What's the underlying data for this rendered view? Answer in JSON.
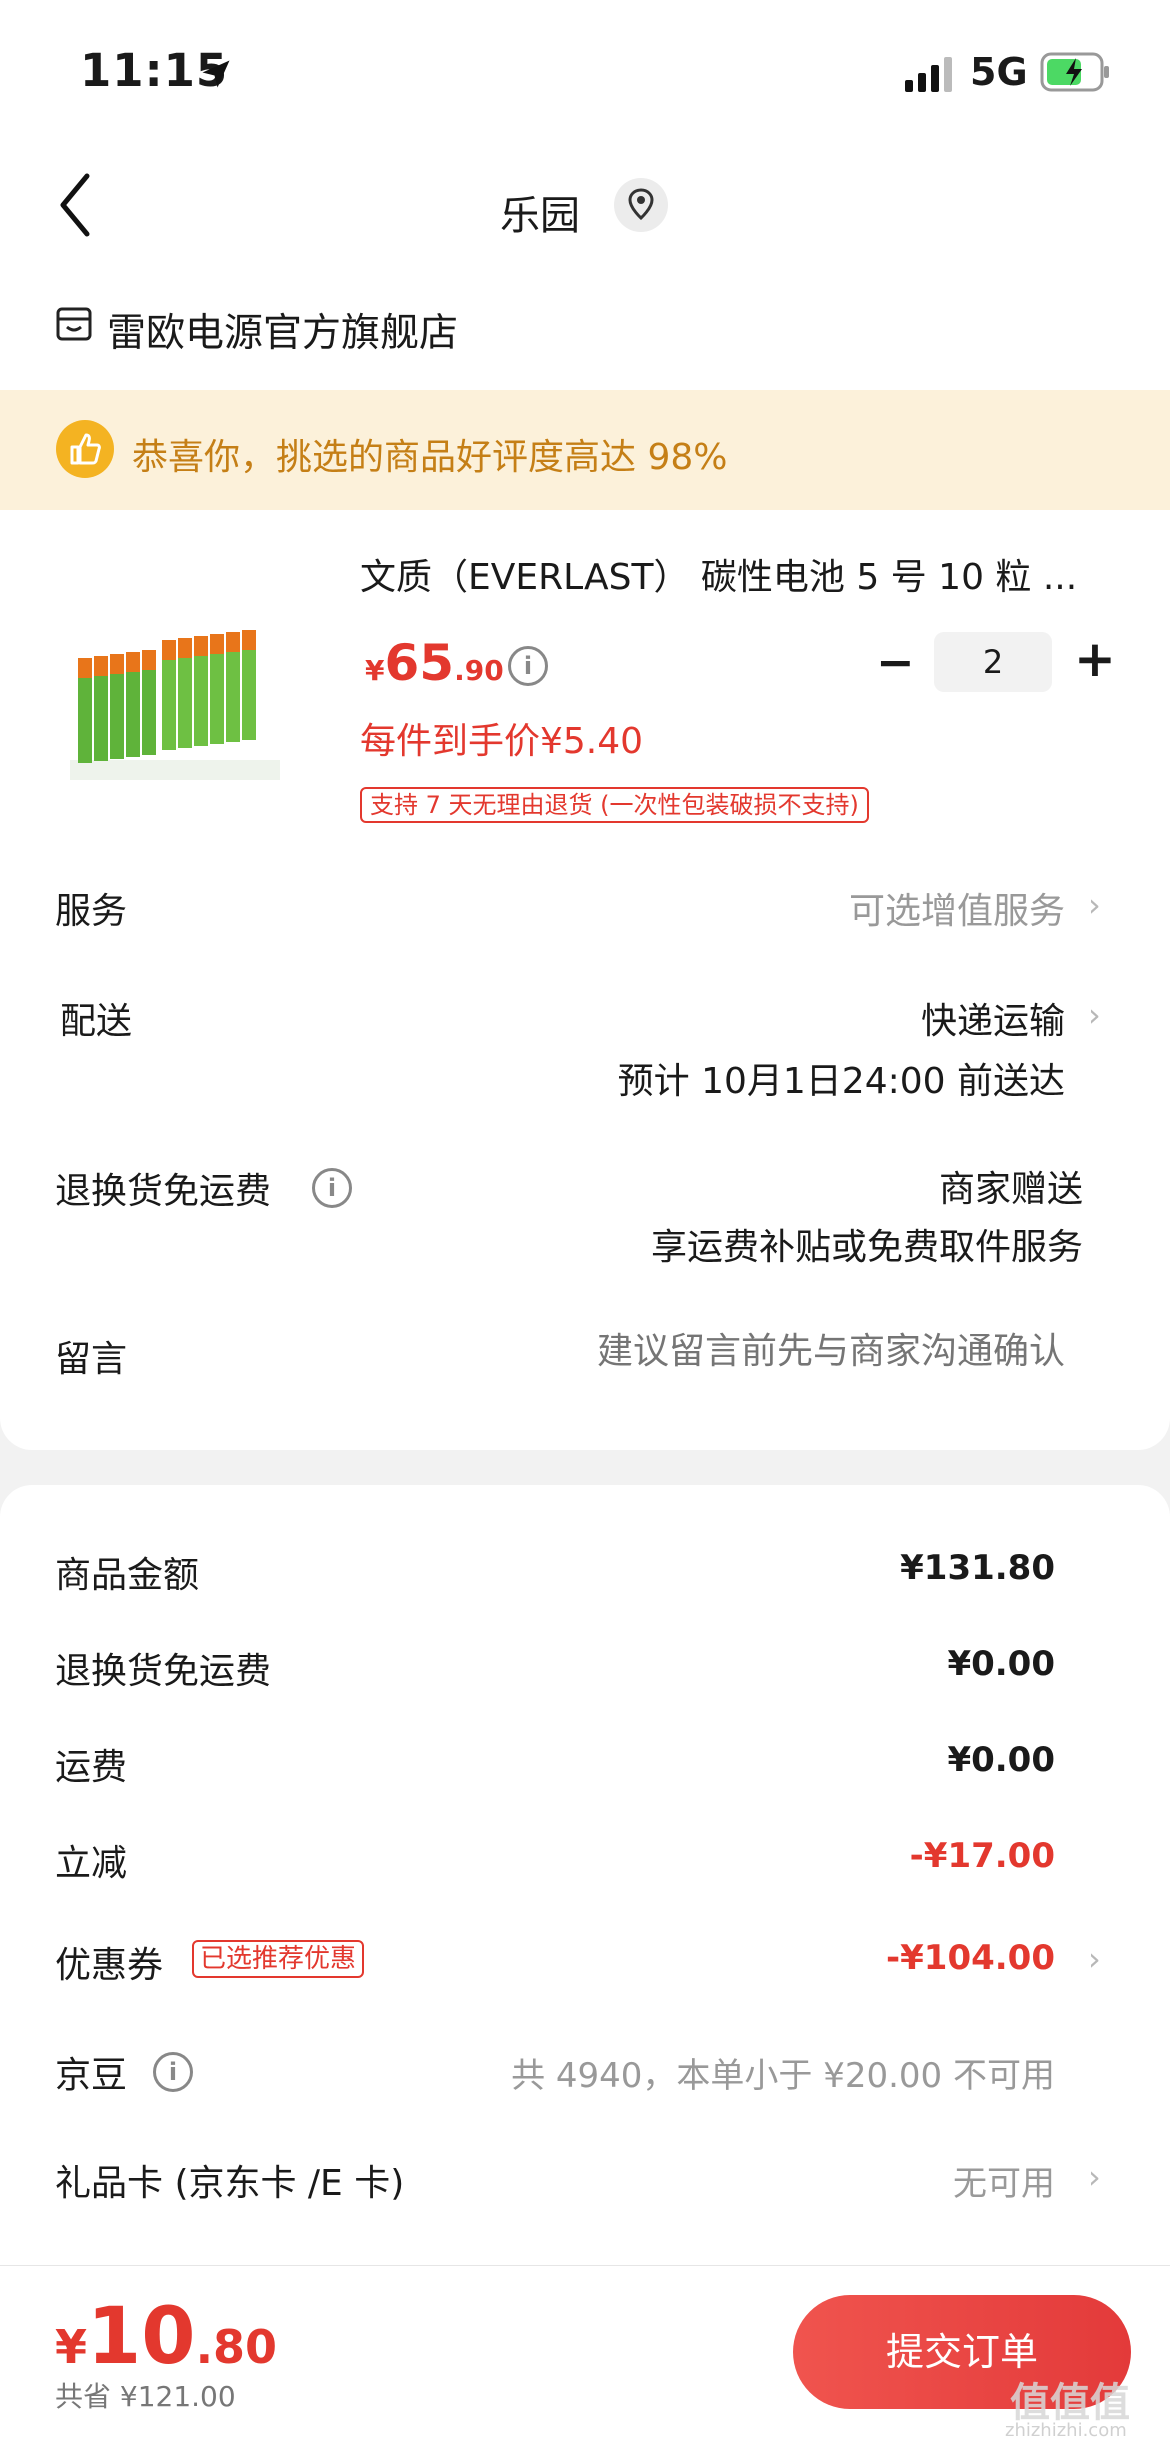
{
  "status_bar": {
    "time": "11:15",
    "network": "5G"
  },
  "header": {
    "title": "乐园"
  },
  "store": {
    "name": "雷欧电源官方旗舰店"
  },
  "banner": {
    "text": "恭喜你，挑选的商品好评度高达 98%"
  },
  "product": {
    "title": "文质（EVERLAST） 碳性电池 5 号 10 粒 ...",
    "price_currency": "¥",
    "price_int": "65",
    "price_dec": ".90",
    "quantity": "2",
    "unit_price": "每件到手价¥5.40",
    "return_policy": "支持 7 天无理由退货 (一次性包装破损不支持)"
  },
  "order_rows": {
    "service": {
      "label": "服务",
      "value": "可选增值服务"
    },
    "delivery": {
      "label": "配送",
      "value": "快递运输",
      "eta": "预计 10月1日24:00 前送达"
    },
    "return_shipping": {
      "label": "退换货免运费",
      "value": "商家赠送",
      "detail": "享运费补贴或免费取件服务"
    },
    "message": {
      "label": "留言",
      "placeholder": "建议留言前先与商家沟通确认"
    }
  },
  "summary": {
    "goods_amount": {
      "label": "商品金额",
      "value": "¥131.80"
    },
    "return_fee": {
      "label": "退换货免运费",
      "value": "¥0.00"
    },
    "shipping": {
      "label": "运费",
      "value": "¥0.00"
    },
    "discount": {
      "label": "立减",
      "value": "-¥17.00"
    },
    "coupon": {
      "label": "优惠券",
      "tag": "已选推荐优惠",
      "value": "-¥104.00"
    },
    "jingdou": {
      "label": "京豆",
      "value": "共 4940，本单小于 ¥20.00 不可用"
    },
    "gift_card": {
      "label": "礼品卡 (京东卡 /E 卡)",
      "value": "无可用"
    }
  },
  "footer": {
    "total_currency": "¥",
    "total_int": "10",
    "total_dec": ".80",
    "saved": "共省 ¥121.00",
    "submit_label": "提交订单"
  },
  "watermark": {
    "text": "值值值",
    "sub": "zhizhizhi.com"
  },
  "colors": {
    "accent": "#e3382e",
    "banner_bg": "#fcf1da",
    "banner_text": "#c57f16"
  }
}
